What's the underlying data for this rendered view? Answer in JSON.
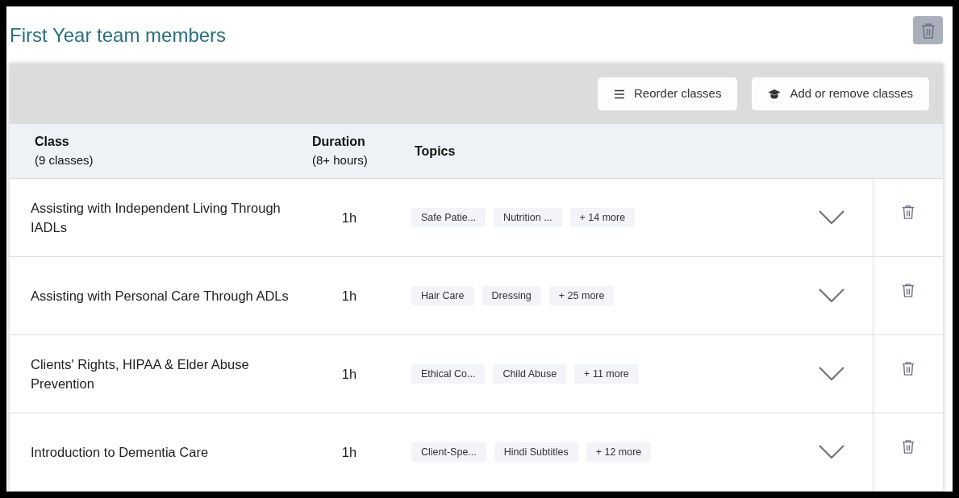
{
  "title": "First Year team members",
  "toolbar": {
    "buttons": [
      {
        "kind": "reorder",
        "label": "Reorder classes"
      },
      {
        "kind": "add",
        "label": "Add or remove classes"
      }
    ]
  },
  "table": {
    "columns": [
      {
        "label": "Class",
        "sub": "(9 classes)"
      },
      {
        "label": "Duration",
        "sub": "(8+ hours)"
      },
      {
        "label": "Topics"
      }
    ],
    "rows": [
      {
        "class": "Assisting with Independent Living Through IADLs",
        "duration": "1h",
        "topics": [
          "Safe Patie...",
          "Nutrition ...",
          "+ 14 more"
        ]
      },
      {
        "class": "Assisting with Personal Care Through ADLs",
        "duration": "1h",
        "topics": [
          "Hair Care",
          "Dressing",
          "+ 25 more"
        ]
      },
      {
        "class": "Clients' Rights, HIPAA & Elder Abuse Prevention",
        "duration": "1h",
        "topics": [
          "Ethical Co...",
          "Child Abuse",
          "+ 11 more"
        ]
      },
      {
        "class": "Introduction to Dementia Care",
        "duration": "1h",
        "topics": [
          "Client-Spe...",
          "Hindi Subtitles",
          "+ 12 more"
        ]
      }
    ]
  }
}
